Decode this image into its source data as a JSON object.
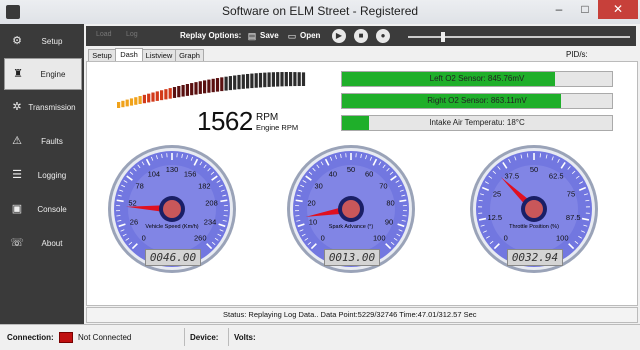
{
  "window": {
    "title": "Software on ELM Street - Registered",
    "minimize": "–",
    "maximize": "□",
    "close": "✕"
  },
  "sidebar": {
    "items": [
      {
        "label": "Setup",
        "icon": "gear-icon",
        "glyph": "⚙"
      },
      {
        "label": "Engine",
        "icon": "engine-icon",
        "glyph": "♜"
      },
      {
        "label": "Transmission",
        "icon": "transmission-gear-icon",
        "glyph": "✲"
      },
      {
        "label": "Faults",
        "icon": "faults-icon",
        "glyph": "⚠"
      },
      {
        "label": "Logging",
        "icon": "list-icon",
        "glyph": "☰"
      },
      {
        "label": "Console",
        "icon": "console-chip-icon",
        "glyph": "▣"
      },
      {
        "label": "About",
        "icon": "about-chat-icon",
        "glyph": "☏"
      }
    ],
    "active_index": 1
  },
  "toolbar": {
    "dim1": "Load",
    "dim2": "Log",
    "replay_label": "Replay Options:",
    "save_label": "Save",
    "open_label": "Open",
    "save_glyph": "▤",
    "open_glyph": "▭",
    "play_glyph": "▶",
    "stop_glyph": "■",
    "record_glyph": "●",
    "slider_position": 0.15
  },
  "tabs": [
    {
      "label": "Setup"
    },
    {
      "label": "Dash"
    },
    {
      "label": "Listview"
    },
    {
      "label": "Graph"
    }
  ],
  "active_tab": 1,
  "pid_label": "PID/s:",
  "rpm": {
    "value": "1562",
    "unit": "RPM",
    "sublabel": "Engine RPM",
    "lit_fraction": 0.3
  },
  "bars": [
    {
      "label": "Left O2 Sensor: 845.76mV",
      "fill": 0.79
    },
    {
      "label": "Right O2 Sensor: 863.11mV",
      "fill": 0.81
    },
    {
      "label": "Intake Air Temperatu: 18°C",
      "fill": 0.1
    }
  ],
  "gauges": [
    {
      "caption": "Vehicle Speed (Km/h)",
      "ticks": [
        "0",
        "26",
        "52",
        "78",
        "104",
        "130",
        "156",
        "182",
        "208",
        "234",
        "260"
      ],
      "min": 0,
      "max": 260,
      "value": 46,
      "readout": "0046.00"
    },
    {
      "caption": "Spark Advance (°)",
      "ticks": [
        "0",
        "10",
        "20",
        "30",
        "40",
        "50",
        "60",
        "70",
        "80",
        "90",
        "100"
      ],
      "min": 0,
      "max": 100,
      "value": 13,
      "readout": "0013.00"
    },
    {
      "caption": "Throttle Position (%)",
      "ticks": [
        "0",
        "12.5",
        "25",
        "37.5",
        "50",
        "62.5",
        "75",
        "87.5",
        "100"
      ],
      "min": 0,
      "max": 100,
      "value": 32.94,
      "readout": "0032.94"
    }
  ],
  "status": {
    "text": "Status: Replaying Log Data..  Data Point:5229/32746    Time:47.01/312.57 Sec"
  },
  "statusbar": {
    "connection_label": "Connection:",
    "connection_value": "Not Connected",
    "device_label": "Device:",
    "volts_label": "Volts:",
    "indicator_color": "#c01010"
  }
}
